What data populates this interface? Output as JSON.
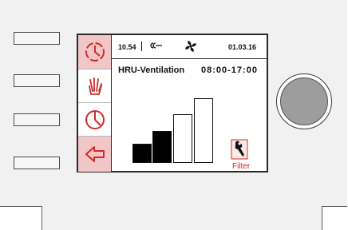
{
  "statusbar": {
    "time": "10.54",
    "date": "01.03.16",
    "connection_icon": "connection-icon",
    "fan_icon": "fan-icon"
  },
  "main": {
    "mode": "HRU-Ventilation",
    "schedule": "08:00-17:00",
    "ventilation_level": 2,
    "ventilation_levels_total": 4
  },
  "sidebar": {
    "items": [
      {
        "icon": "timer-icon",
        "active": true
      },
      {
        "icon": "hand-icon",
        "active": false
      },
      {
        "icon": "clock-icon",
        "active": false
      },
      {
        "icon": "back-arrow-icon",
        "active": true
      }
    ]
  },
  "filter": {
    "label": "Filter",
    "icon": "wrench-icon"
  },
  "colors": {
    "accent_red": "#d12a2a",
    "active_highlight": "#f1c6c6",
    "bezel": "#f1f1f1",
    "knob": "#9d9d9d"
  }
}
